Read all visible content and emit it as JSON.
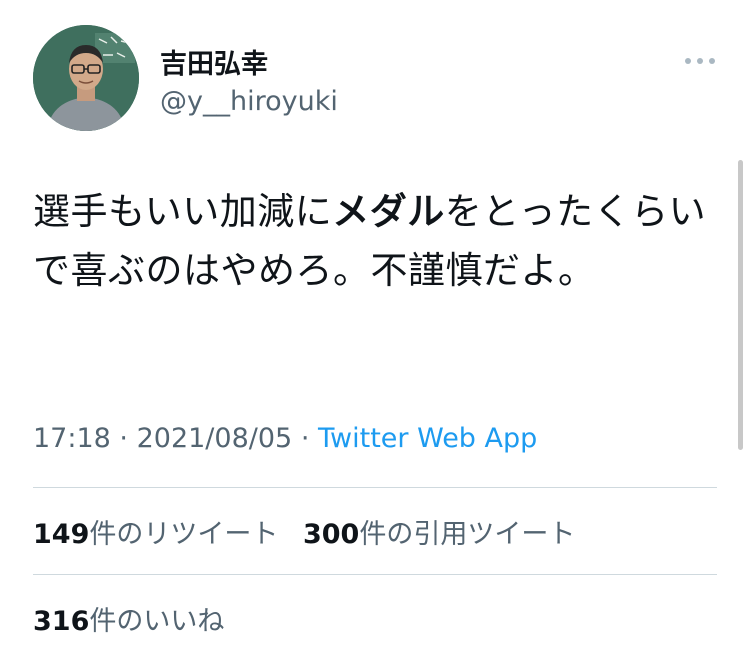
{
  "author": {
    "display_name": "吉田弘幸",
    "handle": "@y__hiroyuki",
    "avatar_icon": "profile-photo"
  },
  "tweet": {
    "text_part1": "選手もいい加減に",
    "text_bold": "メダル",
    "text_part2": "をとったくらいで喜ぶのはやめろ。不謹慎だよ。"
  },
  "meta": {
    "time": "17:18",
    "separator": "·",
    "date": "2021/08/05",
    "source": "Twitter Web App"
  },
  "stats": {
    "retweets_count": "149",
    "retweets_label": "件のリツイート",
    "quotes_count": "300",
    "quotes_label": "件の引用ツイート",
    "likes_count": "316",
    "likes_label": "件のいいね"
  },
  "colors": {
    "text_primary": "#0f1419",
    "text_secondary": "#536471",
    "link": "#1d9bf0",
    "divider": "#cfd9de"
  }
}
